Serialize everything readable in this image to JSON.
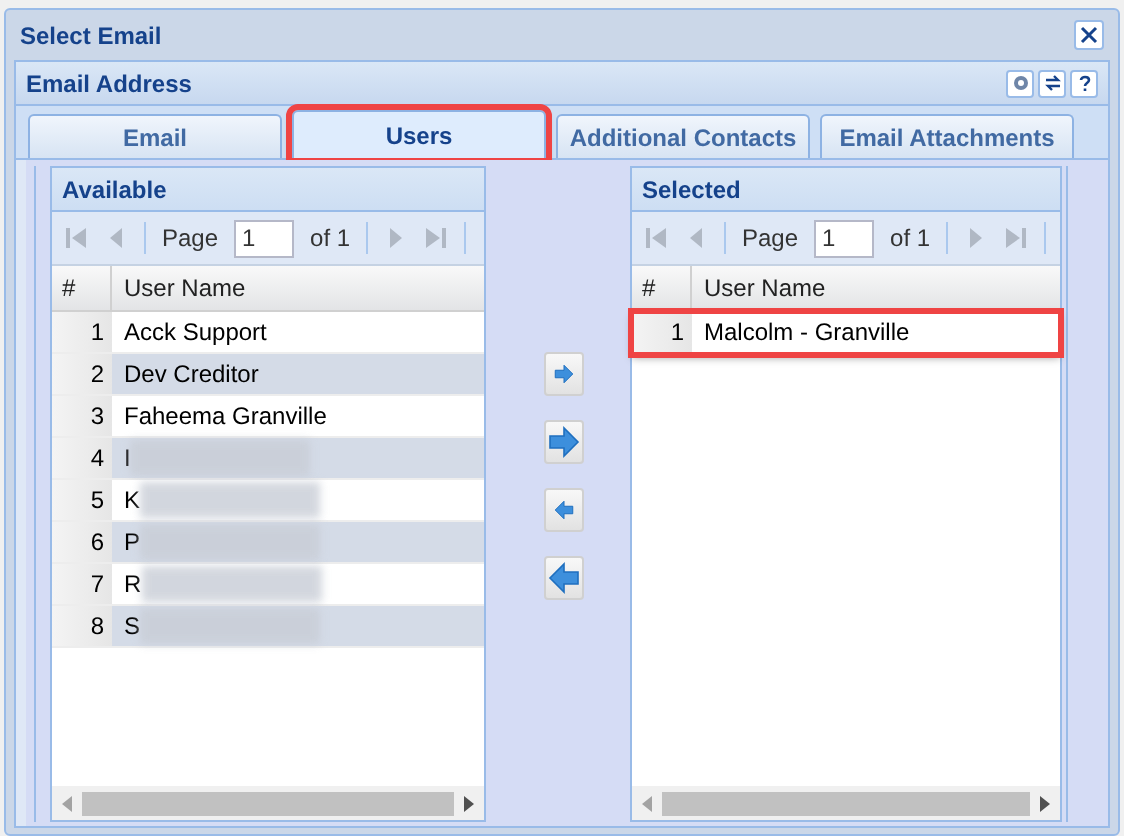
{
  "dialog": {
    "title": "Select Email"
  },
  "panel": {
    "title": "Email Address"
  },
  "tabs": [
    {
      "label": "Email",
      "selected": false,
      "highlighted": false
    },
    {
      "label": "Users",
      "selected": true,
      "highlighted": true
    },
    {
      "label": "Additional Contacts",
      "selected": false,
      "highlighted": false
    },
    {
      "label": "Email Attachments",
      "selected": false,
      "highlighted": false
    }
  ],
  "available": {
    "title": "Available",
    "pager": {
      "page_label": "Page",
      "page": "1",
      "of": "of 1"
    },
    "columns": [
      "#",
      "User Name"
    ],
    "rows": [
      {
        "index": "1",
        "name": "Acck Support",
        "redacted": false,
        "highlighted": false
      },
      {
        "index": "2",
        "name": "Dev Creditor",
        "redacted": false,
        "highlighted": false
      },
      {
        "index": "3",
        "name": "Faheema Granville",
        "redacted": false,
        "highlighted": false
      },
      {
        "index": "4",
        "name": "I",
        "redacted": true,
        "highlighted": false
      },
      {
        "index": "5",
        "name": "K",
        "redacted": true,
        "highlighted": false
      },
      {
        "index": "6",
        "name": "P",
        "redacted": true,
        "highlighted": false
      },
      {
        "index": "7",
        "name": "R",
        "redacted": true,
        "highlighted": false
      },
      {
        "index": "8",
        "name": "S",
        "redacted": true,
        "highlighted": false
      }
    ]
  },
  "selected_list": {
    "title": "Selected",
    "pager": {
      "page_label": "Page",
      "page": "1",
      "of": "of 1"
    },
    "columns": [
      "#",
      "User Name"
    ],
    "rows": [
      {
        "index": "1",
        "name": "Malcolm - Granville",
        "redacted": false,
        "highlighted": true
      }
    ]
  }
}
